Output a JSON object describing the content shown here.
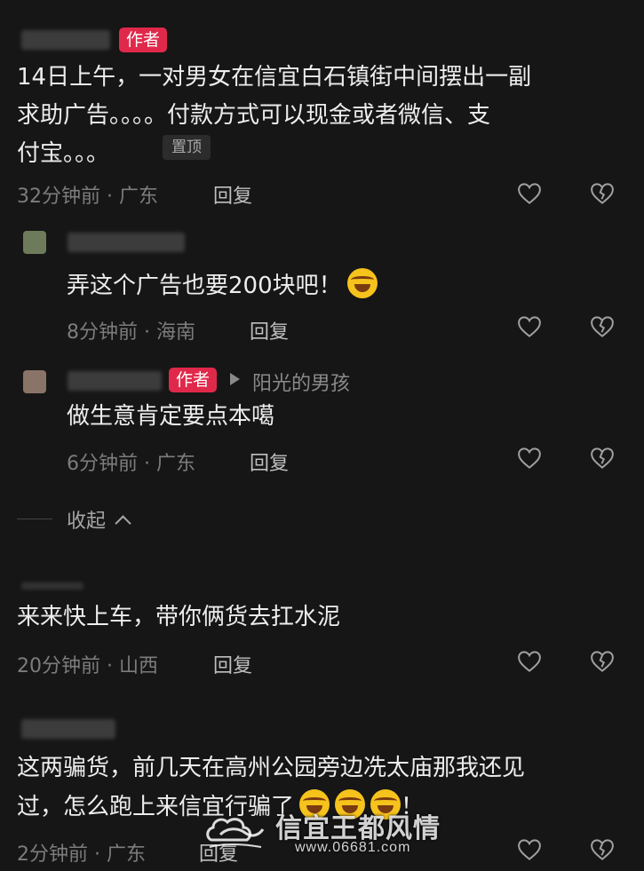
{
  "author_badge": "作者",
  "pinned_label": "置顶",
  "reply_label": "回复",
  "collapse_label": "收起",
  "comment1": {
    "text": "14日上午，一对男女在信宜白石镇街中间摆出一副求助广告。。。。付款方式可以现金或者微信、支付宝。。。",
    "line1": "14日上午，一对男女在信宜白石镇街中间摆出一副",
    "line2": "求助广告。。。。付款方式可以现金或者微信、支",
    "line3": "付宝。。。",
    "meta": "32分钟前 · 广东"
  },
  "reply1": {
    "text": "弄这个广告也要200块吧！",
    "meta": "8分钟前 · 海南"
  },
  "reply2": {
    "reply_to": "阳光的男孩",
    "text": "做生意肯定要点本噶",
    "meta": "6分钟前 · 广东"
  },
  "comment2": {
    "text": "来来快上车，带你俩货去扛水泥",
    "meta": "20分钟前 · 山西"
  },
  "comment3": {
    "line1": "这两骗货，前几天在高州公园旁边冼太庙那我还见",
    "line2": "过，怎么跑上来信宜行骗了",
    "line2_end": "！",
    "meta": "2分钟前 · 广东"
  },
  "watermark": {
    "title": "信宜王都风情",
    "url": "www.06681.com"
  },
  "icons": [
    "like-heart-icon",
    "dislike-broken-heart-icon",
    "reply-arrow-icon",
    "chevron-up-icon",
    "laughing-emoji-icon"
  ]
}
